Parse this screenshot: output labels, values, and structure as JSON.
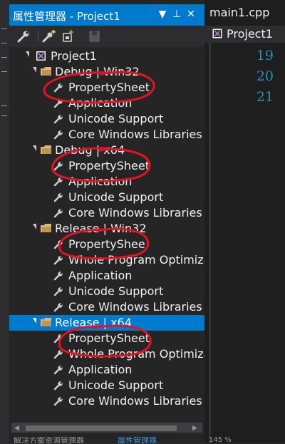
{
  "left_strip": {
    "label": "解决方案资源管理器  属性"
  },
  "panel": {
    "title": "属性管理器 - Project1",
    "buttons": [
      "▼",
      "⊥",
      "✕"
    ]
  },
  "toolbar": {
    "items": [
      "properties-wrench",
      "add-new-property-sheet",
      "add-existing-property-sheet",
      "save"
    ]
  },
  "tree": {
    "project": "Project1",
    "configs": [
      {
        "label": "Debug | Win32",
        "sheets": [
          "PropertySheet",
          "Application",
          "Unicode Support",
          "Core Windows Libraries"
        ]
      },
      {
        "label": "Debug | x64",
        "sheets": [
          "PropertySheet",
          "Application",
          "Unicode Support",
          "Core Windows Libraries"
        ]
      },
      {
        "label": "Release | Win32",
        "sheets": [
          "PropertyShee",
          "Whole Program Optimizat",
          "Application",
          "Unicode Support",
          "Core Windows Libraries"
        ]
      },
      {
        "label": "Release | x64",
        "selected": true,
        "sheets": [
          "PropertySheet",
          "Whole Program Optimizat",
          "Application",
          "Unicode Support",
          "Core Windows Libraries"
        ]
      }
    ]
  },
  "bottom_tabs": [
    "解决方案资源管理器",
    "属性管理器"
  ],
  "editor": {
    "tab": "main1.cpp",
    "nav": "Project1",
    "line_numbers": [
      "19",
      "20",
      "21"
    ],
    "zoom": "145 %"
  },
  "colors": {
    "accent": "#007acc",
    "annotation": "#e81123",
    "line_number": "#2b91af"
  }
}
